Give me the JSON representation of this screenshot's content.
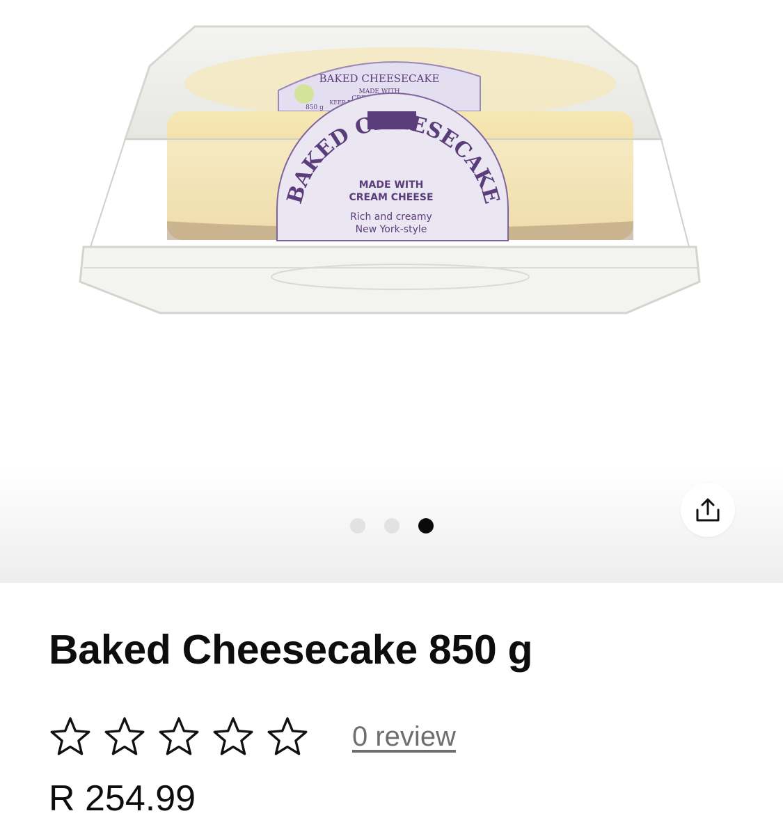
{
  "product": {
    "title": "Baked Cheesecake 850 g",
    "price": "R 254.99",
    "rating": 0,
    "rating_max": 5,
    "review_text": "0 review"
  },
  "gallery": {
    "image_count": 3,
    "active_index": 2,
    "image_label": {
      "top_label": "BAKED CHEESECAKE",
      "top_line1": "MADE WITH",
      "top_line2": "CREAM CHEESE",
      "keep": "KEEP REFRIGERATED",
      "weight": "850 g",
      "arc_title": "BAKED CHEESECAKE",
      "line1": "MADE WITH",
      "line2": "CREAM CHEESE",
      "line3": "Rich and creamy",
      "line4": "New York-style"
    }
  },
  "colors": {
    "label_purple": "#5a3d7a",
    "label_bg": "#ebe7f2",
    "title_text": "#0d0d0d",
    "review_link": "#6e6e6e",
    "dot_active": "#0a0a0a",
    "dot_inactive": "#e2e2e2"
  },
  "icons": {
    "share": "share-upload-icon",
    "star": "star-outline-icon"
  }
}
